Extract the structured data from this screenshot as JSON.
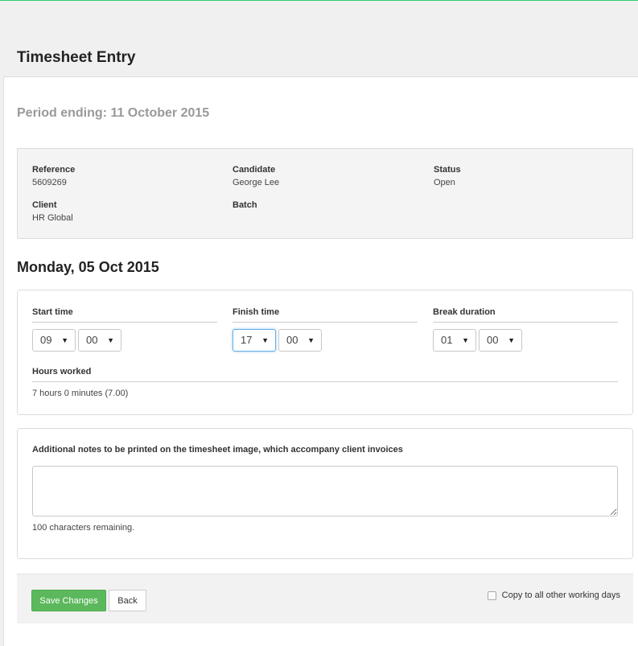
{
  "header": {
    "title": "Timesheet Entry"
  },
  "period": {
    "text": "Period ending: 11 October 2015"
  },
  "info": {
    "reference": {
      "label": "Reference",
      "value": "5609269"
    },
    "candidate": {
      "label": "Candidate",
      "value": "George Lee"
    },
    "status": {
      "label": "Status",
      "value": "Open"
    },
    "client": {
      "label": "Client",
      "value": "HR Global"
    },
    "batch": {
      "label": "Batch",
      "value": ""
    }
  },
  "day": {
    "title": "Monday, 05 Oct 2015"
  },
  "times": {
    "start": {
      "label": "Start time",
      "hour": "09",
      "minute": "00"
    },
    "finish": {
      "label": "Finish time",
      "hour": "17",
      "minute": "00"
    },
    "break": {
      "label": "Break duration",
      "hour": "01",
      "minute": "00"
    },
    "hours_label": "Hours worked",
    "hours_value": "7 hours 0 minutes (7.00)"
  },
  "notes": {
    "label": "Additional notes to be printed on the timesheet image, which accompany client invoices",
    "value": "",
    "remaining": "100 characters remaining."
  },
  "actions": {
    "save_label": "Save Changes",
    "back_label": "Back",
    "copy_label": "Copy to all other working days"
  },
  "colors": {
    "accent_green": "#5cb85c",
    "top_line": "#2ecc71",
    "focus_blue": "#66afe9"
  }
}
